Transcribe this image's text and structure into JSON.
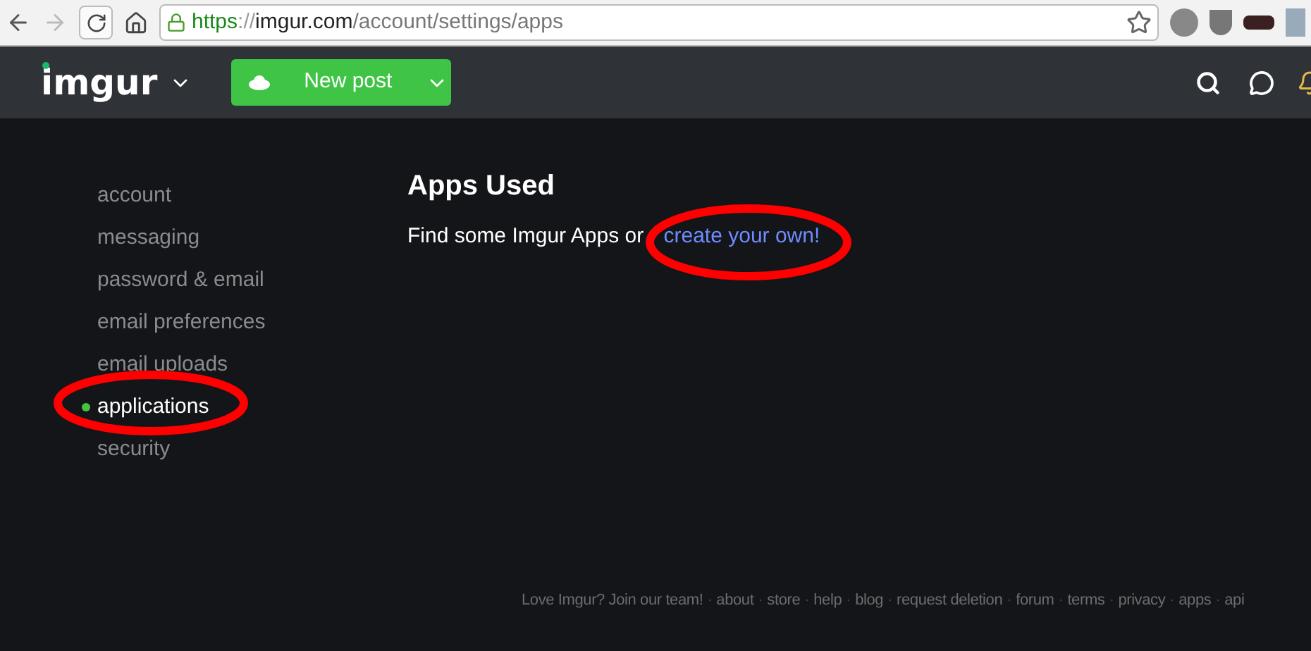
{
  "browser": {
    "url_scheme": "https",
    "url_sep": "://",
    "url_host": "imgur.com",
    "url_path": "/account/settings/apps"
  },
  "nav": {
    "logo": "imgur",
    "new_post": "New post"
  },
  "sidebar": {
    "items": [
      {
        "label": "account",
        "selected": false
      },
      {
        "label": "messaging",
        "selected": false
      },
      {
        "label": "password & email",
        "selected": false
      },
      {
        "label": "email preferences",
        "selected": false
      },
      {
        "label": "email uploads",
        "selected": false
      },
      {
        "label": "applications",
        "selected": true
      },
      {
        "label": "security",
        "selected": false
      }
    ]
  },
  "main": {
    "title": "Apps Used",
    "text": "Find some Imgur Apps or",
    "link": "create your own!"
  },
  "footer": {
    "items": [
      "Love Imgur? Join our team!",
      "about",
      "store",
      "help",
      "blog",
      "request deletion",
      "forum",
      "terms",
      "privacy",
      "apps",
      "api"
    ],
    "separator": "·"
  }
}
